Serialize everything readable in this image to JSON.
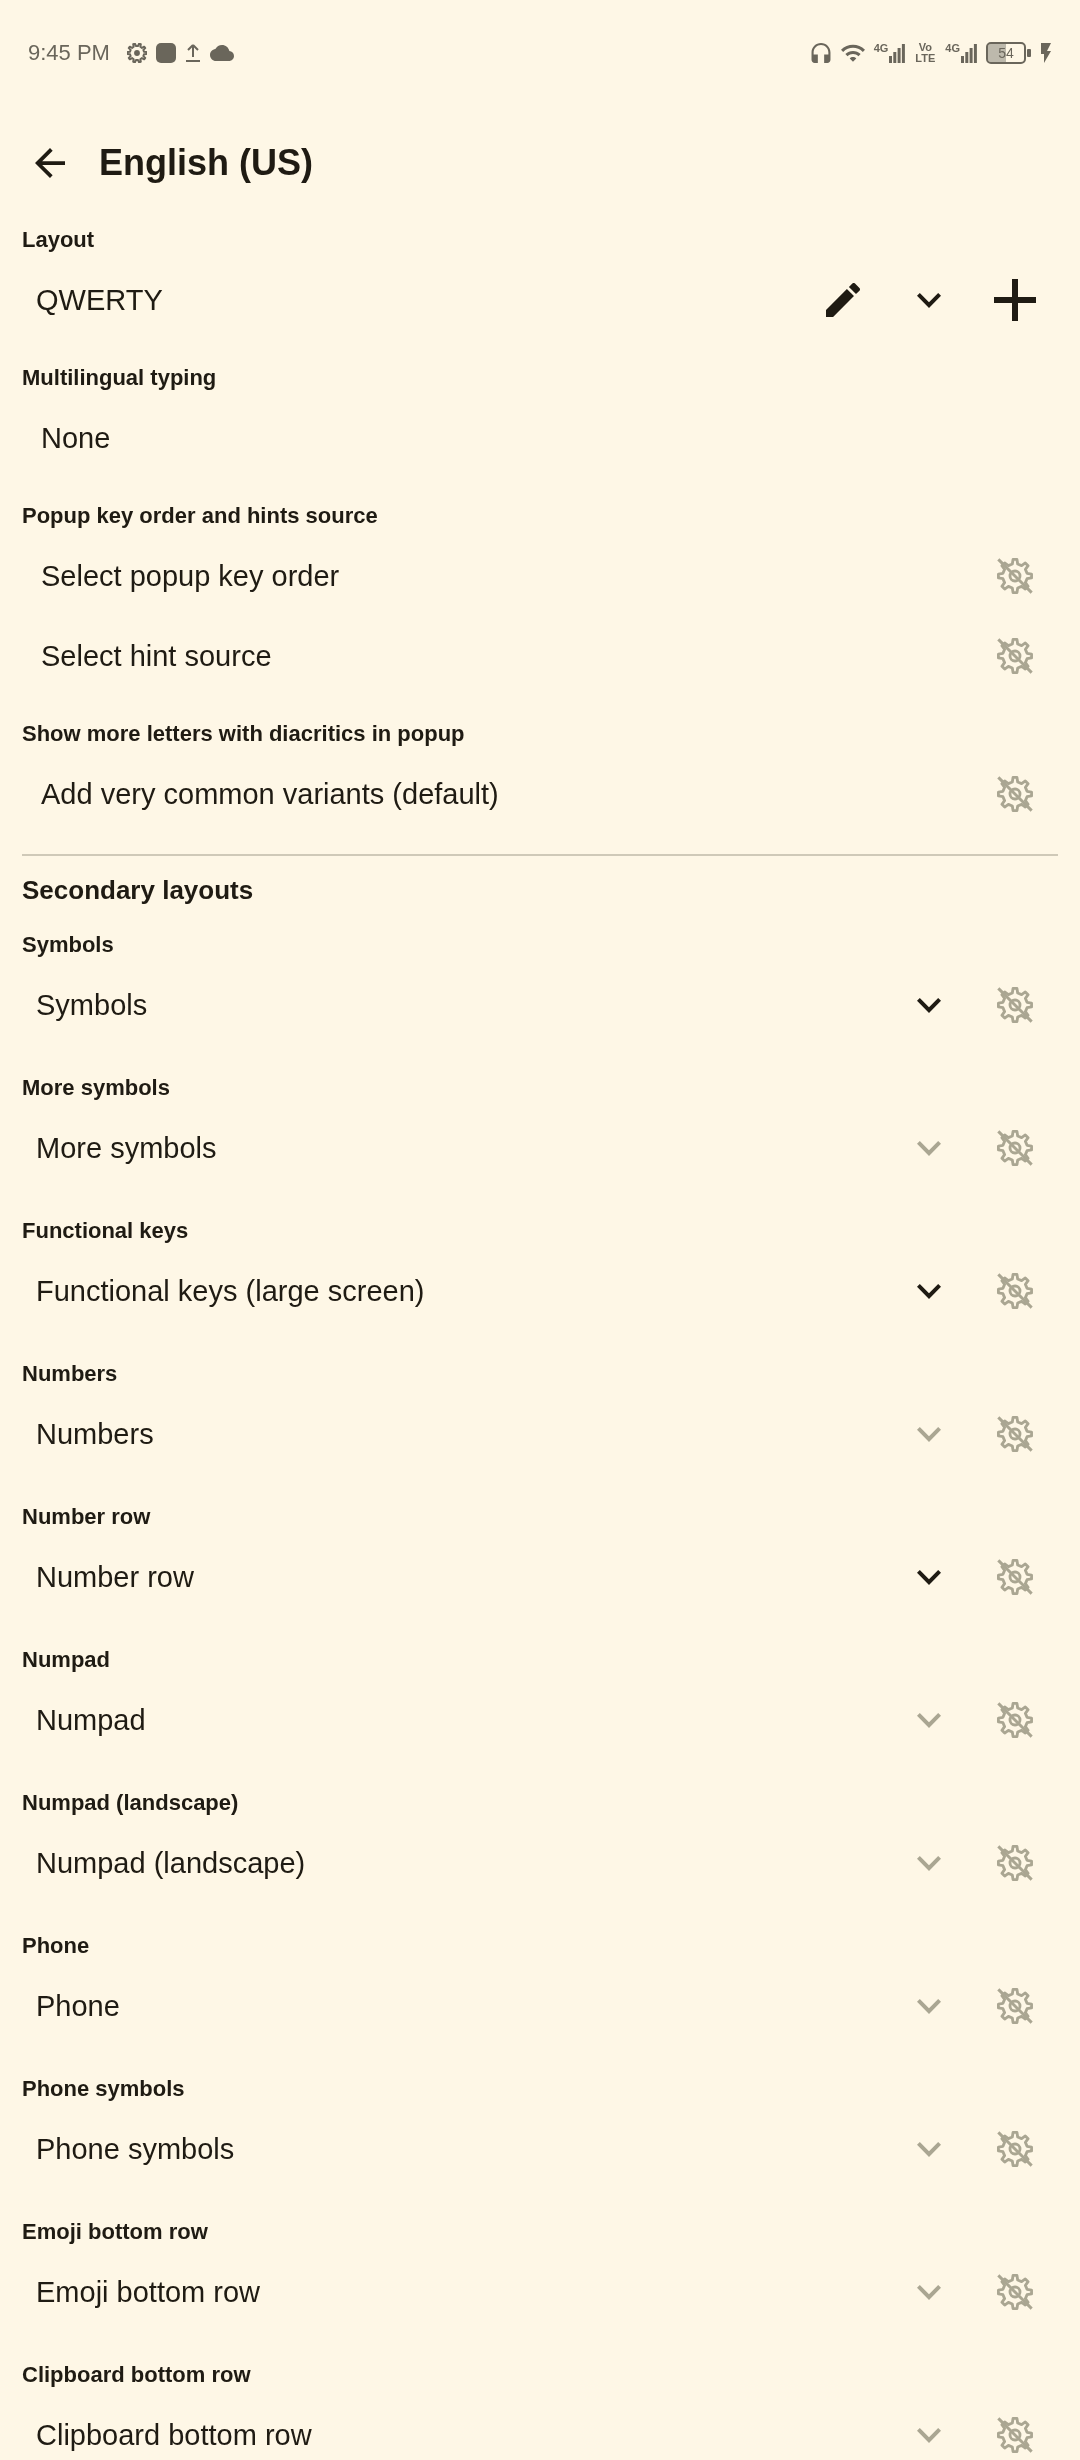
{
  "status_bar": {
    "time": "9:45 PM",
    "network_1": "4G",
    "volte": "Vo LTE",
    "network_2": "4G",
    "battery": "54"
  },
  "header": {
    "title": "English (US)"
  },
  "settings": [
    {
      "label": "Layout",
      "rows": [
        {
          "kind": "layout",
          "value": "QWERTY",
          "dropdown_disabled": false
        }
      ]
    },
    {
      "label": "Multilingual typing",
      "rows": [
        {
          "kind": "plain",
          "value": "None"
        }
      ]
    },
    {
      "label": "Popup key order and hints source",
      "rows": [
        {
          "kind": "setting",
          "value": "Select popup key order"
        },
        {
          "kind": "setting",
          "value": "Select hint source"
        }
      ]
    },
    {
      "label": "Show more letters with diacritics in popup",
      "rows": [
        {
          "kind": "setting",
          "value": "Add very common variants (default)"
        }
      ]
    }
  ],
  "secondary_layouts": {
    "heading": "Secondary layouts",
    "items": [
      {
        "label": "Symbols",
        "value": "Symbols",
        "dropdown_disabled": false
      },
      {
        "label": "More symbols",
        "value": "More symbols",
        "dropdown_disabled": true
      },
      {
        "label": "Functional keys",
        "value": "Functional keys (large screen)",
        "dropdown_disabled": false
      },
      {
        "label": "Numbers",
        "value": "Numbers",
        "dropdown_disabled": true
      },
      {
        "label": "Number row",
        "value": "Number row",
        "dropdown_disabled": false
      },
      {
        "label": "Numpad",
        "value": "Numpad",
        "dropdown_disabled": true
      },
      {
        "label": "Numpad (landscape)",
        "value": "Numpad (landscape)",
        "dropdown_disabled": true
      },
      {
        "label": "Phone",
        "value": "Phone",
        "dropdown_disabled": true
      },
      {
        "label": "Phone symbols",
        "value": "Phone symbols",
        "dropdown_disabled": true
      },
      {
        "label": "Emoji bottom row",
        "value": "Emoji bottom row",
        "dropdown_disabled": true
      },
      {
        "label": "Clipboard bottom row",
        "value": "Clipboard bottom row",
        "dropdown_disabled": true
      }
    ]
  }
}
